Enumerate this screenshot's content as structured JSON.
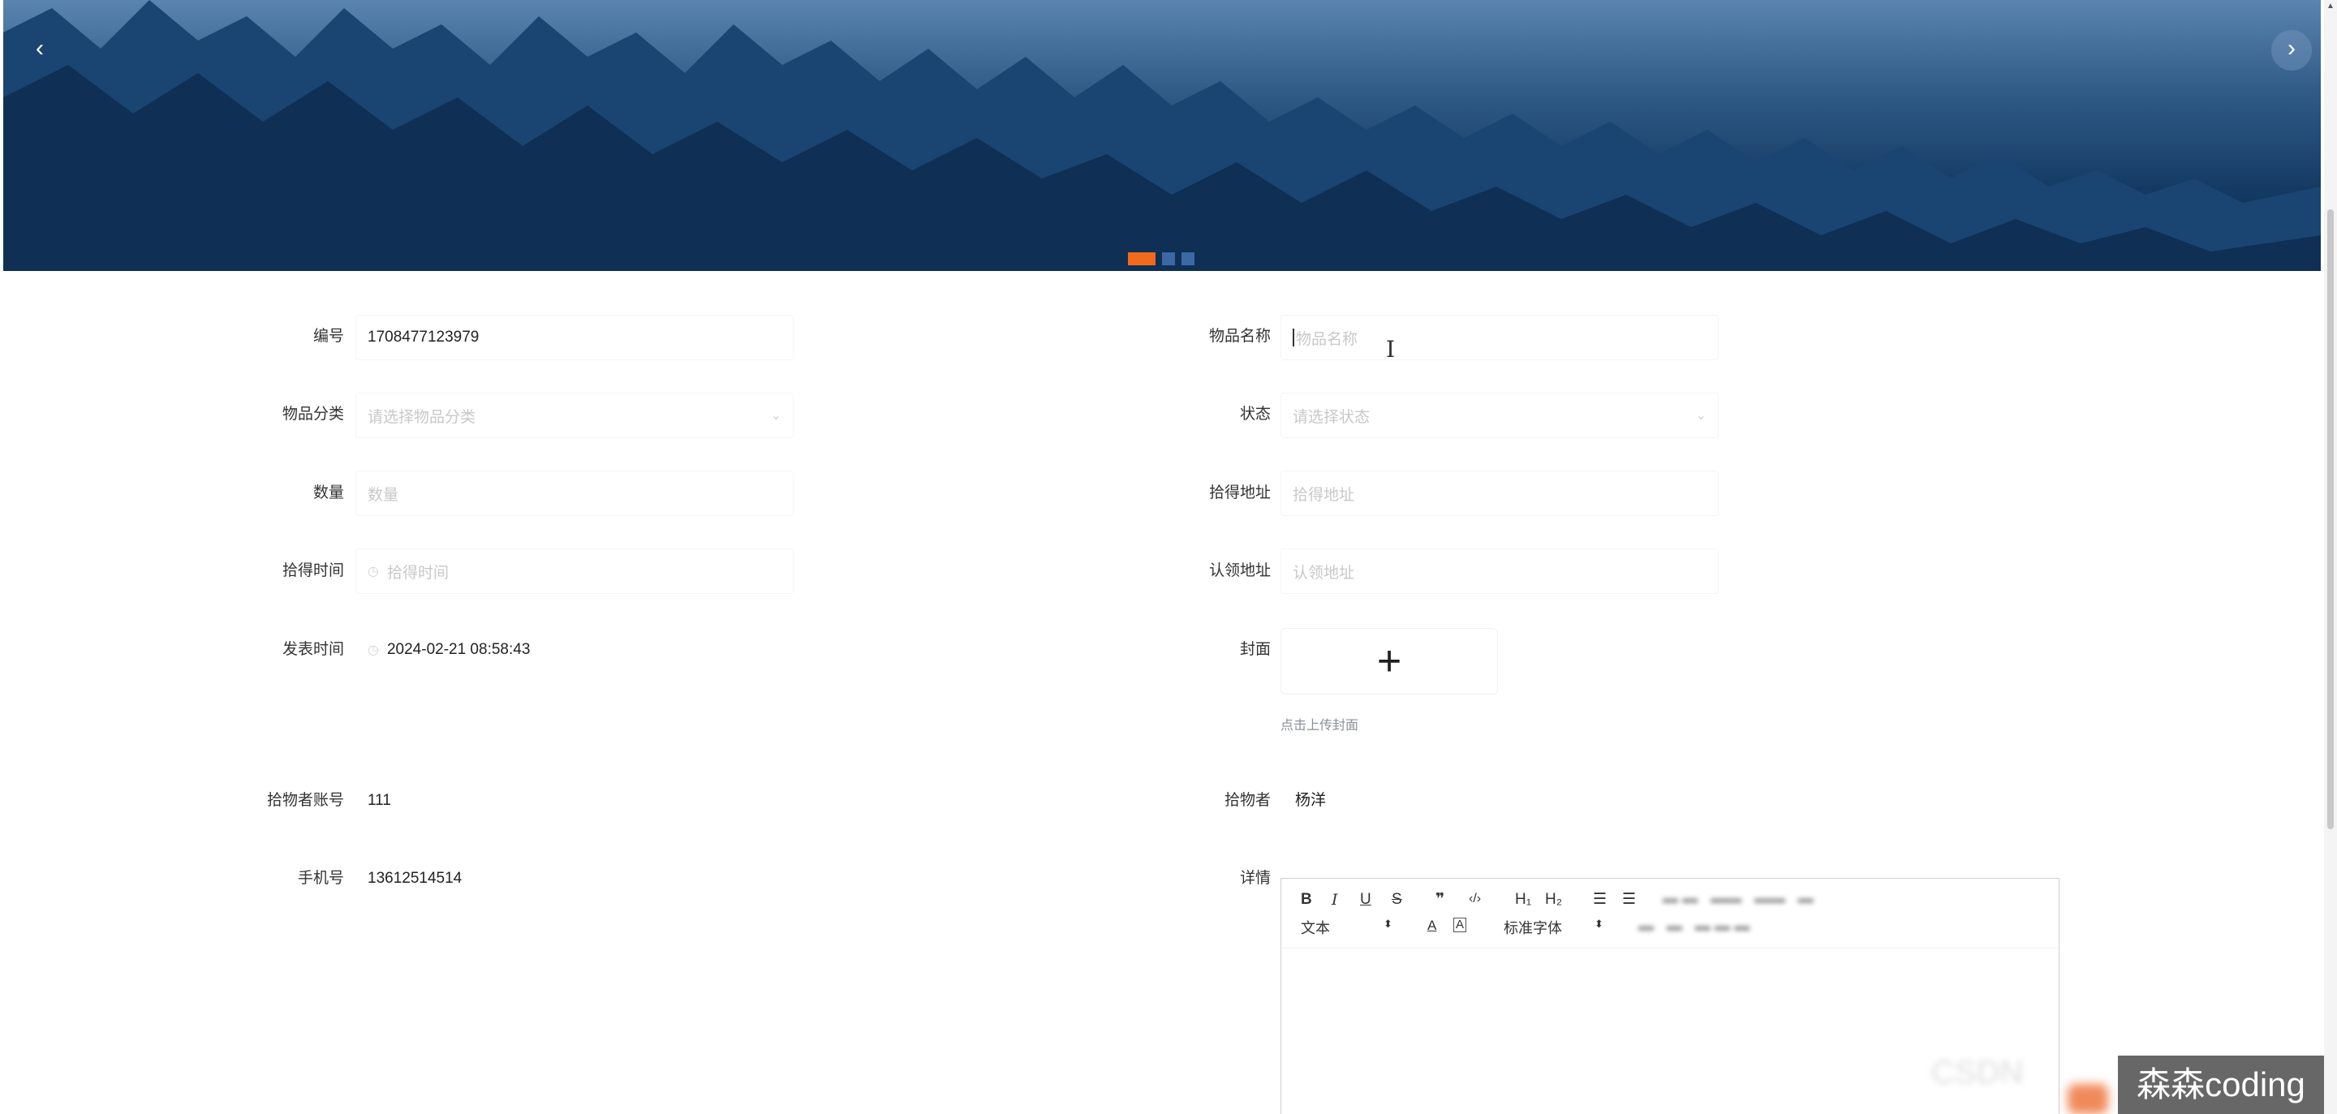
{
  "banner": {
    "prev_icon": "‹",
    "next_icon": "›",
    "dots": [
      {
        "active": true
      },
      {
        "active": false
      },
      {
        "active": false
      }
    ],
    "accent_color": "#f26a1b"
  },
  "form": {
    "number": {
      "label": "编号",
      "value": "1708477123979"
    },
    "item_name": {
      "label": "物品名称",
      "placeholder": "物品名称"
    },
    "category": {
      "label": "物品分类",
      "placeholder": "请选择物品分类"
    },
    "status": {
      "label": "状态",
      "placeholder": "请选择状态"
    },
    "quantity": {
      "label": "数量",
      "placeholder": "数量"
    },
    "found_address": {
      "label": "拾得地址",
      "placeholder": "拾得地址"
    },
    "found_time": {
      "label": "拾得时间",
      "placeholder": "拾得时间"
    },
    "claim_address": {
      "label": "认领地址",
      "placeholder": "认领地址"
    },
    "publish_time": {
      "label": "发表时间",
      "value": "2024-02-21 08:58:43"
    },
    "cover": {
      "label": "封面",
      "plus": "+",
      "tip": "点击上传封面"
    },
    "finder_account": {
      "label": "拾物者账号",
      "value": "111"
    },
    "finder": {
      "label": "拾物者",
      "value": "杨洋"
    },
    "phone": {
      "label": "手机号",
      "value": "13612514514"
    },
    "details": {
      "label": "详情"
    }
  },
  "editor": {
    "bold": "B",
    "italic": "I",
    "underline": "U",
    "strike": "S",
    "quote": "❞",
    "code": "‹/›",
    "h1": "H₁",
    "h2": "H₂",
    "ordered_list": "☰",
    "bullet_list": "☰",
    "text_style": "文本",
    "font_color": "A",
    "bg_color": "A",
    "font_family": "标准字体"
  },
  "watermark": "森森coding"
}
